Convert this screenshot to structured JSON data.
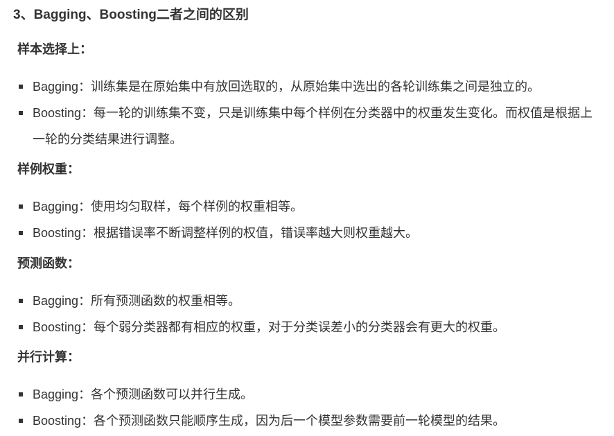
{
  "title": "3、Bagging、Boosting二者之间的区别",
  "sections": [
    {
      "heading": "样本选择上：",
      "items": [
        {
          "term": "Bagging",
          "text": "：训练集是在原始集中有放回选取的，从原始集中选出的各轮训练集之间是独立的。"
        },
        {
          "term": "Boosting",
          "text": "：每一轮的训练集不变，只是训练集中每个样例在分类器中的权重发生变化。而权值是根据上一轮的分类结果进行调整。"
        }
      ]
    },
    {
      "heading": "样例权重：",
      "items": [
        {
          "term": "Bagging",
          "text": "：使用均匀取样，每个样例的权重相等。"
        },
        {
          "term": "Boosting",
          "text": "：根据错误率不断调整样例的权值，错误率越大则权重越大。"
        }
      ]
    },
    {
      "heading": "预测函数：",
      "items": [
        {
          "term": "Bagging",
          "text": "：所有预测函数的权重相等。"
        },
        {
          "term": "Boosting",
          "text": "：每个弱分类器都有相应的权重，对于分类误差小的分类器会有更大的权重。"
        }
      ]
    },
    {
      "heading": "并行计算：",
      "items": [
        {
          "term": "Bagging",
          "text": "：各个预测函数可以并行生成。"
        },
        {
          "term": "Boosting",
          "text": "：各个预测函数只能顺序生成，因为后一个模型参数需要前一轮模型的结果。"
        }
      ]
    }
  ]
}
